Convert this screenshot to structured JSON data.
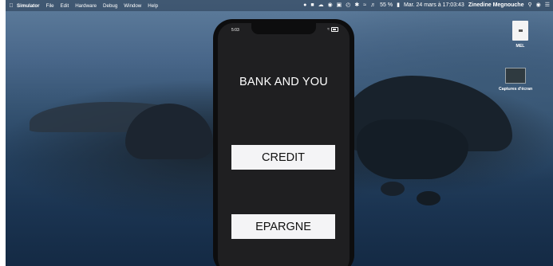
{
  "menubar": {
    "apple_icon": "apple-logo-icon",
    "items": [
      "Simulator",
      "File",
      "Edit",
      "Hardware",
      "Debug",
      "Window",
      "Help"
    ],
    "battery": "55 %",
    "datetime": "Mar. 24 mars à 17:03:43",
    "user": "Zinedine Megnouche"
  },
  "desktop": {
    "icons": [
      {
        "label": "MEL"
      },
      {
        "label": "Captures d'écran"
      }
    ]
  },
  "phone": {
    "status_time": "5:03",
    "app_title": "BANK AND YOU",
    "credit_button": "CREDIT",
    "epargne_button": "EPARGNE"
  }
}
